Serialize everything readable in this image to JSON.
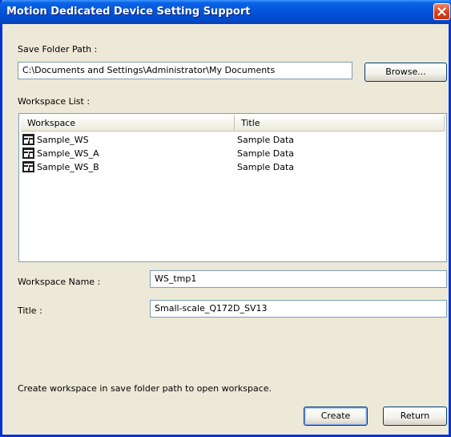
{
  "window": {
    "title": "Motion Dedicated Device Setting Support"
  },
  "save_folder": {
    "label": "Save Folder Path :",
    "value": "C:\\Documents and Settings\\Administrator\\My Documents",
    "browse_label": "Browse..."
  },
  "workspace_list": {
    "label": "Workspace List :",
    "columns": [
      "Workspace",
      "Title"
    ],
    "rows": [
      {
        "name": "Sample_WS",
        "title": "Sample Data"
      },
      {
        "name": "Sample_WS_A",
        "title": "Sample Data"
      },
      {
        "name": "Sample_WS_B",
        "title": "Sample Data"
      }
    ]
  },
  "workspace_name": {
    "label": "Workspace Name :",
    "value": "WS_tmp1"
  },
  "title_field": {
    "label": "Title :",
    "value": "Small-scale_Q172D_SV13"
  },
  "footer": {
    "message": "Create workspace in save folder path to open workspace.",
    "create_label": "Create",
    "return_label": "Return"
  },
  "colors": {
    "titlebar": "#0453D8",
    "close_button": "#D6411C",
    "dialog_bg": "#ECE9D8"
  },
  "icons": {
    "close": "close-icon",
    "workspace": "workspace-icon"
  }
}
